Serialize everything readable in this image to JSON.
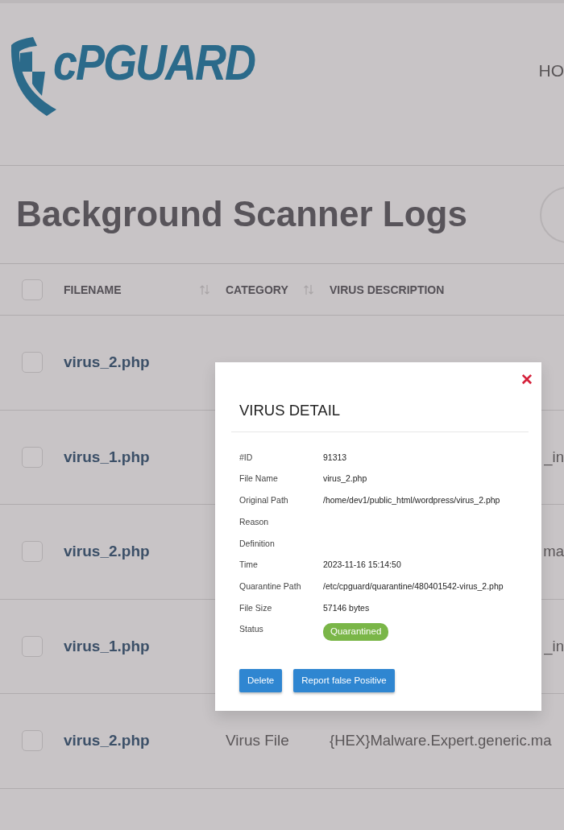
{
  "header": {
    "logo_text": "cPGUARD",
    "nav": [
      "HO"
    ]
  },
  "page_title": "Background Scanner Logs",
  "table": {
    "header_checked": false,
    "columns": [
      {
        "label": "FILENAME",
        "sortable": true
      },
      {
        "label": "CATEGORY",
        "sortable": true
      },
      {
        "label": "VIRUS DESCRIPTION",
        "sortable": false
      }
    ],
    "rows": [
      {
        "checked": false,
        "filename": "virus_2.php"
      },
      {
        "checked": false,
        "filename": "virus_1.php",
        "description_tail": "_in"
      },
      {
        "checked": false,
        "filename": "virus_2.php",
        "description_tail": "ma"
      },
      {
        "checked": false,
        "filename": "virus_1.php",
        "description_tail": "_in"
      },
      {
        "checked": false,
        "filename": "virus_2.php",
        "category": "Virus File",
        "description": "{HEX}Malware.Expert.generic.ma"
      }
    ]
  },
  "modal": {
    "title": "VIRUS DETAIL",
    "close": "✕",
    "details": [
      {
        "label": "#ID",
        "value": "91313"
      },
      {
        "label": "File Name",
        "value": "virus_2.php"
      },
      {
        "label": "Original Path",
        "value": "/home/dev1/public_html/wordpress/virus_2.php"
      },
      {
        "label": "Reason"
      },
      {
        "label": "Definition"
      },
      {
        "label": "Time",
        "value": "2023-11-16 15:14:50"
      },
      {
        "label": "Quarantine Path",
        "value": "/etc/cpguard/quarantine/480401542-virus_2.php"
      },
      {
        "label": "File Size",
        "value": "57146 bytes"
      },
      {
        "label": "Status",
        "badge": "Quarantined",
        "color": "#7ab648"
      }
    ],
    "buttons": [
      "Delete",
      "Report false Positive"
    ]
  }
}
